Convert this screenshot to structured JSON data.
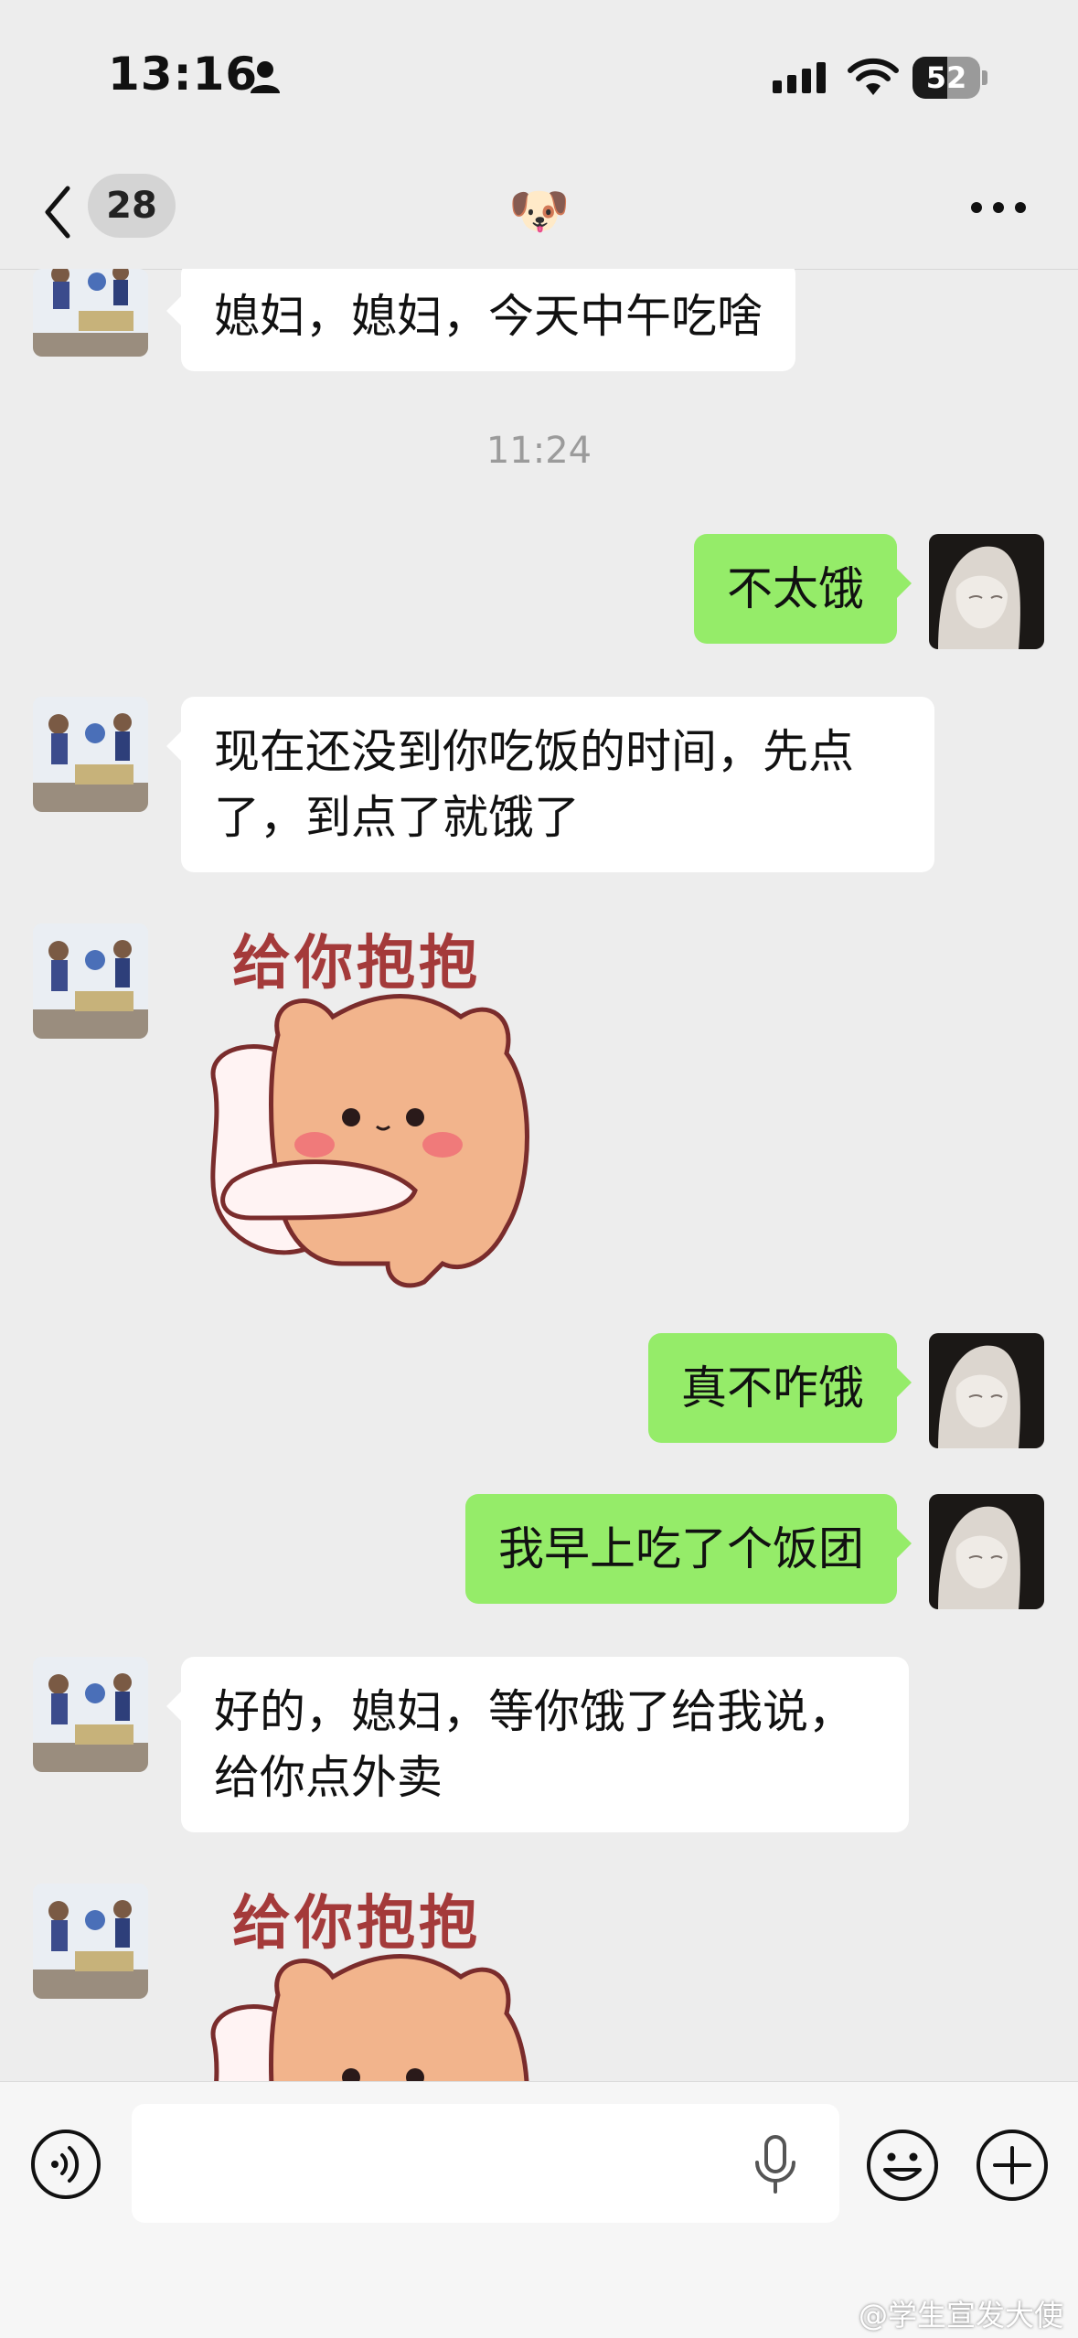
{
  "status_bar": {
    "time": "13:16",
    "battery_level": "52",
    "battery_fraction": 0.52
  },
  "nav": {
    "unread_count": "28",
    "title": "🐶"
  },
  "messages": {
    "m1": "媳妇，媳妇，今天中午吃啥",
    "timestamp": "11:24",
    "m2": "不太饿",
    "m3_line1": "现在还没到你吃饭的时间，先点",
    "m3_line2": "了，到点了就饿了",
    "sticker_caption": "给你抱抱",
    "m5": "真不咋饿",
    "m6": "我早上吃了个饭团",
    "m7_line1": "好的，媳妇，等你饿了给我说，",
    "m7_line2": "给你点外卖",
    "sticker2_caption": "给你抱抱"
  },
  "input": {
    "placeholder": ""
  },
  "watermark": "@学生宣发大使",
  "colors": {
    "background": "#ededed",
    "outgoing_bubble": "#95ec69",
    "incoming_bubble": "#ffffff"
  }
}
